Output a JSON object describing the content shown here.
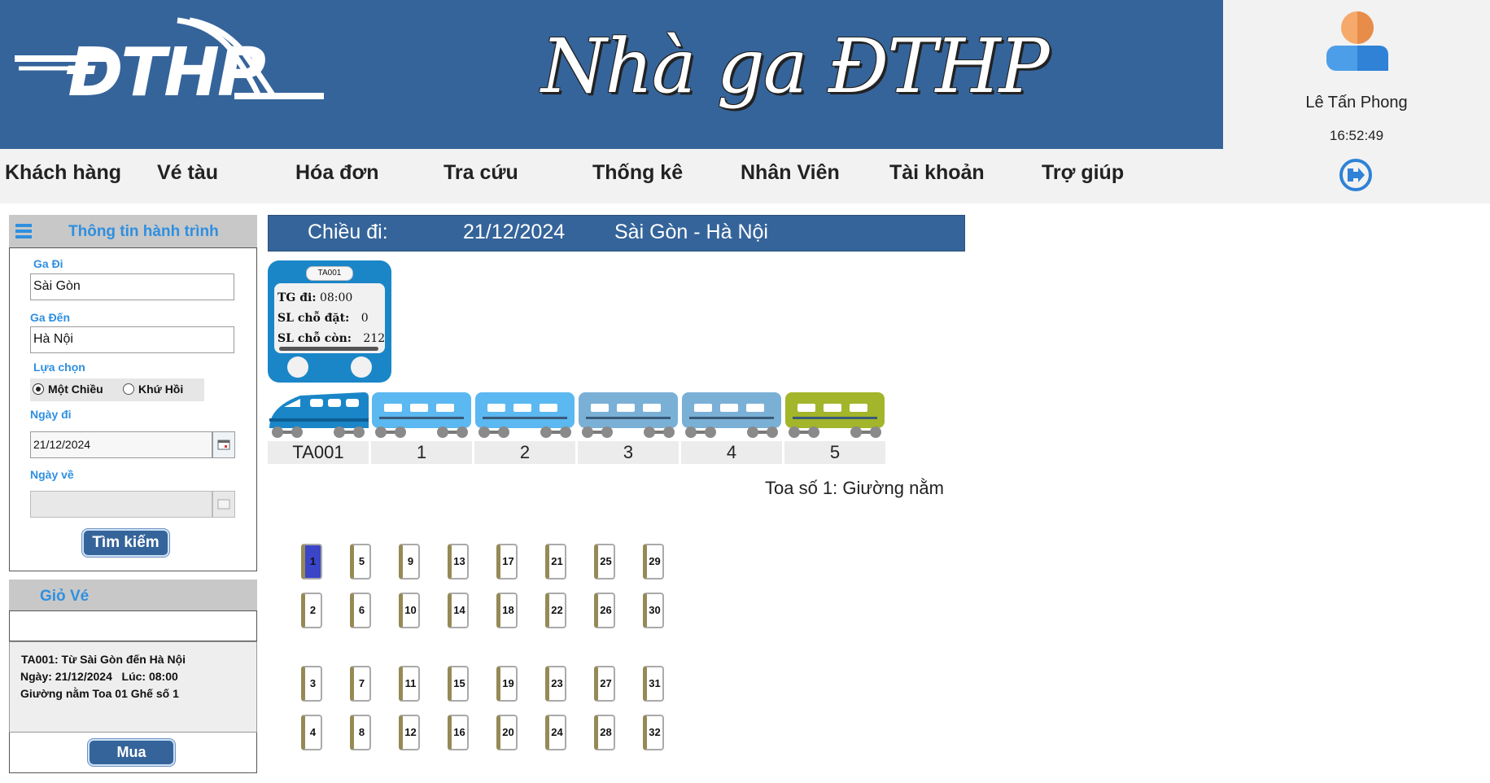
{
  "header": {
    "logo_text": "ĐTHP",
    "title": "Nhà ga ĐTHP"
  },
  "user": {
    "name": "Lê Tấn Phong",
    "time": "16:52:49"
  },
  "menu": [
    "Khách hàng",
    "Vé tàu",
    "Hóa đơn",
    "Tra cứu",
    "Thống kê",
    "Nhân Viên",
    "Tài khoản",
    "Trợ giúp"
  ],
  "journey_panel": {
    "title": "Thông tin hành trình",
    "from_label": "Ga Đi",
    "from_value": "Sài Gòn",
    "to_label": "Ga Đến",
    "to_value": "Hà Nội",
    "option_label": "Lựa chọn",
    "option_one_way": "Một Chiều",
    "option_round_trip": "Khứ Hồi",
    "selected_option": "Một Chiều",
    "depart_label": "Ngày đi",
    "depart_value": "21/12/2024",
    "return_label": "Ngày về",
    "return_value": "",
    "search_button": "Tìm kiếm"
  },
  "cart": {
    "title": "Giỏ Vé",
    "line1": "TA001: Từ Sài Gòn đến Hà Nội",
    "line2": "Ngày: 21/12/2024   Lúc: 08:00",
    "line3": "Giường nằm Toa 01 Ghế số 1",
    "buy_button": "Mua"
  },
  "direction": {
    "label": "Chiều đi:",
    "date": "21/12/2024",
    "route": "Sài Gòn - Hà Nội"
  },
  "train_card": {
    "code": "TA001",
    "depart_label": "TG đi:",
    "depart_value": "08:00",
    "booked_label": "SL chỗ đặt:",
    "booked_value": "0",
    "remaining_label": "SL chỗ còn:",
    "remaining_value": "212"
  },
  "coaches": [
    {
      "label": "TA001",
      "kind": "locomotive",
      "color": "#1a86c8"
    },
    {
      "label": "1",
      "kind": "car",
      "color": "#5bb8f0"
    },
    {
      "label": "2",
      "kind": "car",
      "color": "#5bb8f0"
    },
    {
      "label": "3",
      "kind": "car",
      "color": "#7ab0d6"
    },
    {
      "label": "4",
      "kind": "car",
      "color": "#7ab0d6"
    },
    {
      "label": "5",
      "kind": "car",
      "color": "#a3b52a"
    }
  ],
  "coach_caption": "Toa số 1: Giường nằm",
  "seats": {
    "columns": [
      [
        "1",
        "2",
        "3",
        "4"
      ],
      [
        "5",
        "6",
        "7",
        "8"
      ],
      [
        "9",
        "10",
        "11",
        "12"
      ],
      [
        "13",
        "14",
        "15",
        "16"
      ],
      [
        "17",
        "18",
        "19",
        "20"
      ],
      [
        "21",
        "22",
        "23",
        "24"
      ],
      [
        "25",
        "26",
        "27",
        "28"
      ],
      [
        "29",
        "30",
        "31",
        "32"
      ]
    ],
    "selected": "1"
  },
  "colors": {
    "primary": "#35649a",
    "accent_label": "#2f8fe0",
    "selected_seat": "#3a45c8",
    "seat_edge": "#958a56"
  }
}
